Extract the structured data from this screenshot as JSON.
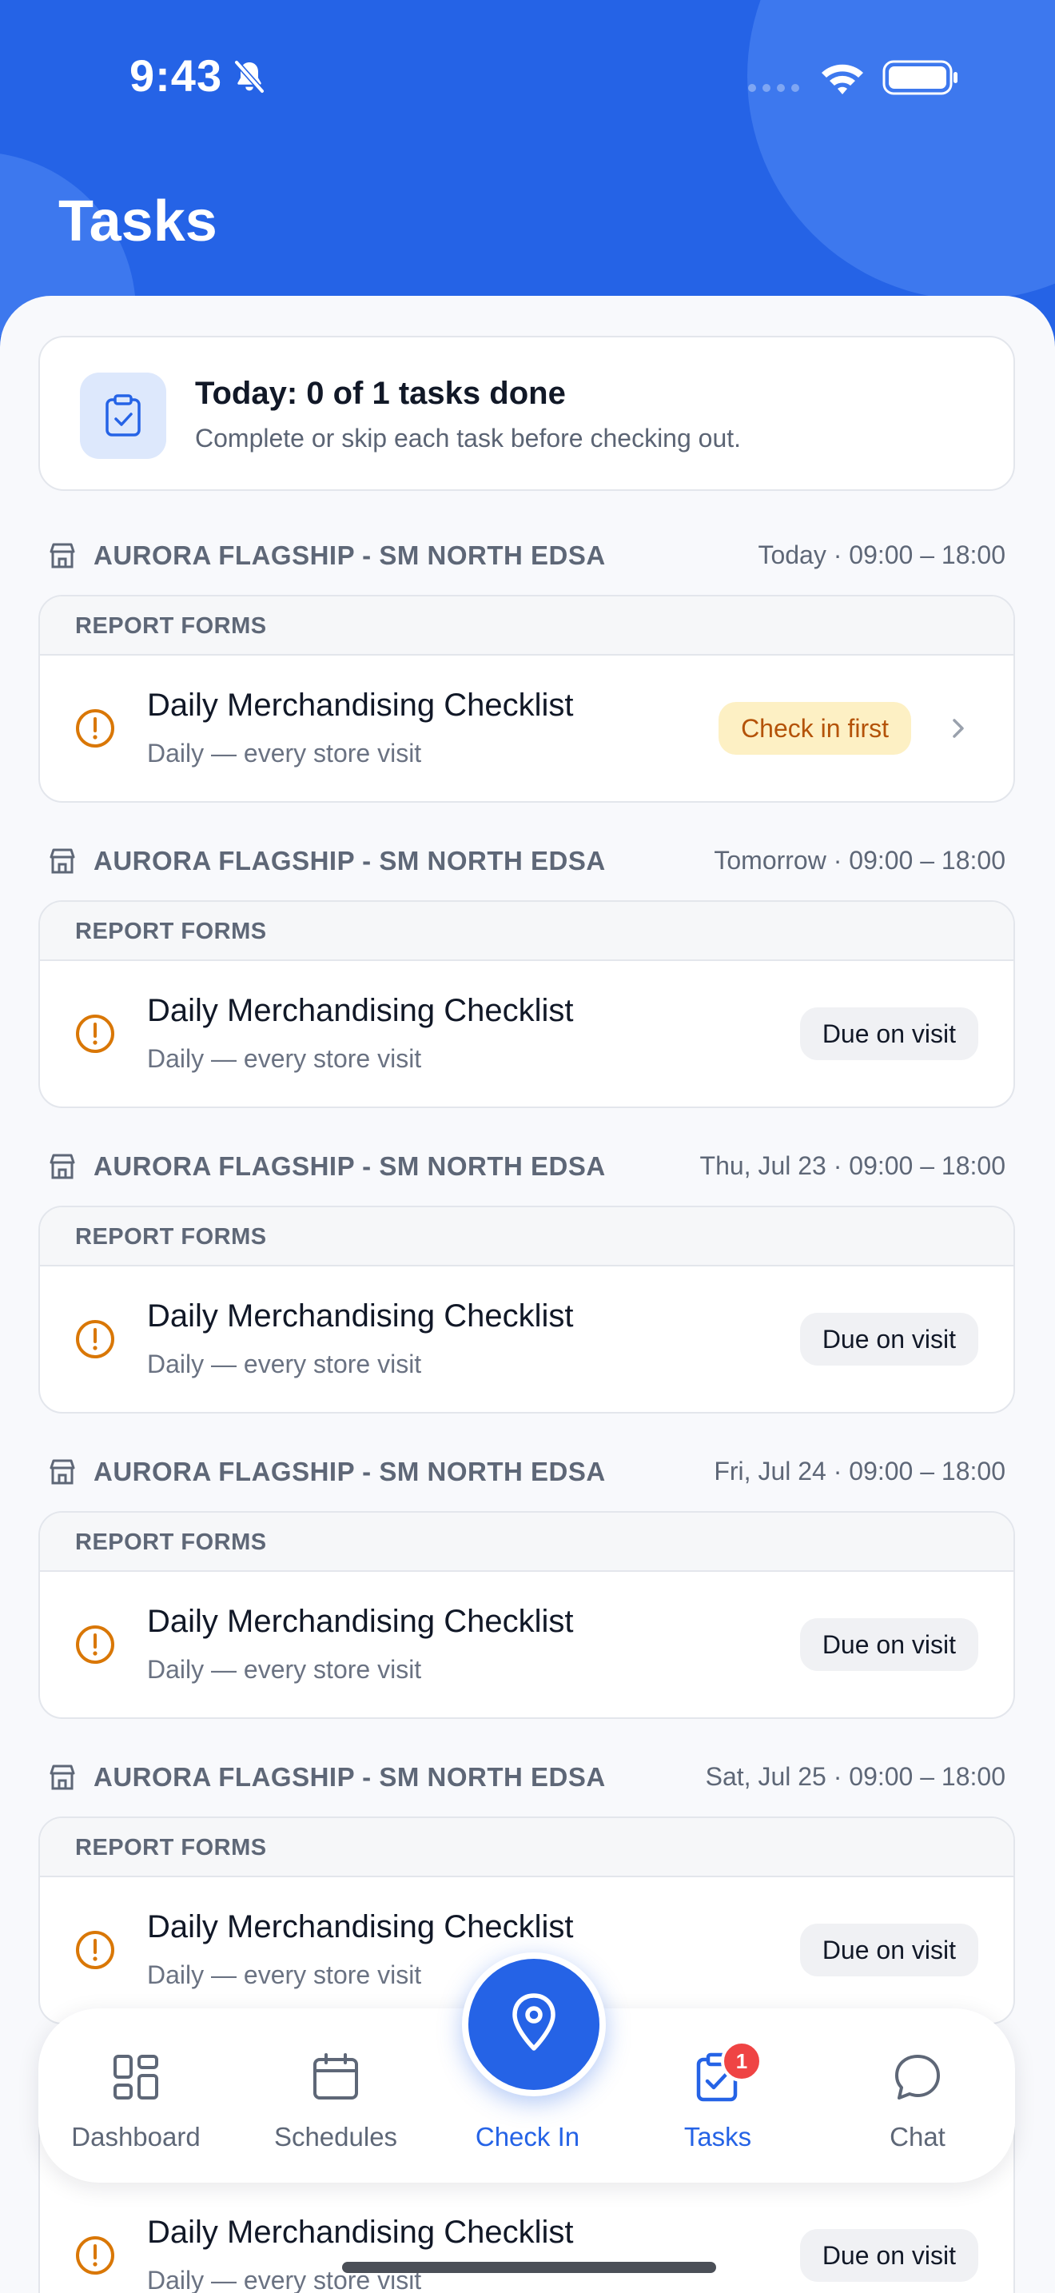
{
  "status_bar": {
    "time": "9:43"
  },
  "header": {
    "title": "Tasks"
  },
  "summary": {
    "title": "Today: 0 of 1 tasks done",
    "subtitle": "Complete or skip each task before checking out."
  },
  "groups": [
    {
      "store": "AURORA FLAGSHIP - SM NORTH EDSA",
      "when": "Today · 09:00 – 18:00",
      "section": "REPORT FORMS",
      "task": {
        "title": "Daily Merchandising Checklist",
        "subtitle": "Daily — every store visit",
        "status": "Check in first"
      }
    },
    {
      "store": "AURORA FLAGSHIP - SM NORTH EDSA",
      "when": "Tomorrow · 09:00 – 18:00",
      "section": "REPORT FORMS",
      "task": {
        "title": "Daily Merchandising Checklist",
        "subtitle": "Daily — every store visit",
        "status": "Due on visit"
      }
    },
    {
      "store": "AURORA FLAGSHIP - SM NORTH EDSA",
      "when": "Thu, Jul 23 · 09:00 – 18:00",
      "section": "REPORT FORMS",
      "task": {
        "title": "Daily Merchandising Checklist",
        "subtitle": "Daily — every store visit",
        "status": "Due on visit"
      }
    },
    {
      "store": "AURORA FLAGSHIP - SM NORTH EDSA",
      "when": "Fri, Jul 24 · 09:00 – 18:00",
      "section": "REPORT FORMS",
      "task": {
        "title": "Daily Merchandising Checklist",
        "subtitle": "Daily — every store visit",
        "status": "Due on visit"
      }
    },
    {
      "store": "AURORA FLAGSHIP - SM NORTH EDSA",
      "when": "Sat, Jul 25 · 09:00 – 18:00",
      "section": "REPORT FORMS",
      "task": {
        "title": "Daily Merchandising Checklist",
        "subtitle": "Daily — every store visit",
        "status": "Due on visit"
      }
    }
  ],
  "peek_task": {
    "title": "Daily Merchandising Checklist",
    "subtitle": "Daily — every store visit",
    "status": "Due on visit"
  },
  "tabbar": {
    "dashboard": "Dashboard",
    "schedules": "Schedules",
    "checkin": "Check In",
    "tasks": "Tasks",
    "tasks_badge": "1",
    "chat": "Chat"
  },
  "colors": {
    "brand": "#2563e6",
    "warning": "#d97706",
    "badge_red": "#ef4444"
  }
}
